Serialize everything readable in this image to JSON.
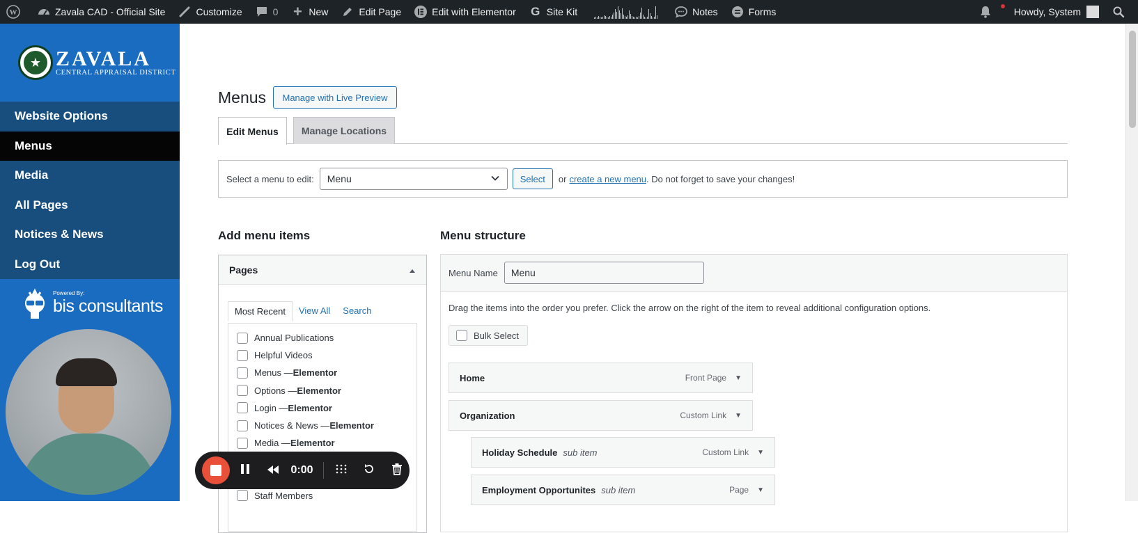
{
  "admin_bar": {
    "site_name": "Zavala CAD - Official Site",
    "customize": "Customize",
    "comments_count": "0",
    "new": "New",
    "edit_page": "Edit Page",
    "edit_elementor": "Edit with Elementor",
    "site_kit": "Site Kit",
    "notes": "Notes",
    "forms": "Forms",
    "howdy": "Howdy, System"
  },
  "sidebar": {
    "logo_title": "ZAVALA",
    "logo_subtitle": "CENTRAL APPRAISAL DISTRICT",
    "items": [
      {
        "label": "Website Options"
      },
      {
        "label": "Menus"
      },
      {
        "label": "Media"
      },
      {
        "label": "All Pages"
      },
      {
        "label": "Notices & News"
      },
      {
        "label": "Log Out"
      }
    ],
    "powered_by": "Powered By:",
    "brand": "bis consultants"
  },
  "recorder": {
    "time": "0:00"
  },
  "main": {
    "title": "Menus",
    "live_preview_btn": "Manage with Live Preview",
    "tabs": [
      {
        "label": "Edit Menus"
      },
      {
        "label": "Manage Locations"
      }
    ],
    "select_label": "Select a menu to edit:",
    "select_value": "Menu",
    "select_btn": "Select",
    "or_text": "or",
    "create_link": "create a new menu",
    "save_note": ". Do not forget to save your changes!"
  },
  "add_items": {
    "heading": "Add menu items",
    "panel_title": "Pages",
    "tabs": {
      "most_recent": "Most Recent",
      "view_all": "View All",
      "search": "Search"
    },
    "pages": [
      {
        "name": "Annual Publications",
        "suffix": ""
      },
      {
        "name": "Helpful Videos",
        "suffix": ""
      },
      {
        "name": "Menus — ",
        "suffix": "Elementor"
      },
      {
        "name": "Options — ",
        "suffix": "Elementor"
      },
      {
        "name": "Login — ",
        "suffix": "Elementor"
      },
      {
        "name": "Notices & News — ",
        "suffix": "Elementor"
      },
      {
        "name": "Media — ",
        "suffix": "Elementor"
      },
      {
        "name": "",
        "suffix": ""
      },
      {
        "name": "",
        "suffix": ""
      },
      {
        "name": "Staff Members",
        "suffix": ""
      }
    ]
  },
  "structure": {
    "heading": "Menu structure",
    "menu_name_label": "Menu Name",
    "menu_name_value": "Menu",
    "instructions": "Drag the items into the order you prefer. Click the arrow on the right of the item to reveal additional configuration options.",
    "bulk_select": "Bulk Select",
    "items": [
      {
        "title": "Home",
        "sub": "",
        "type": "Front Page"
      },
      {
        "title": "Organization",
        "sub": "",
        "type": "Custom Link"
      },
      {
        "title": "Holiday Schedule",
        "sub": "sub item",
        "type": "Custom Link"
      },
      {
        "title": "Employment Opportunites",
        "sub": "sub item",
        "type": "Page"
      }
    ]
  }
}
